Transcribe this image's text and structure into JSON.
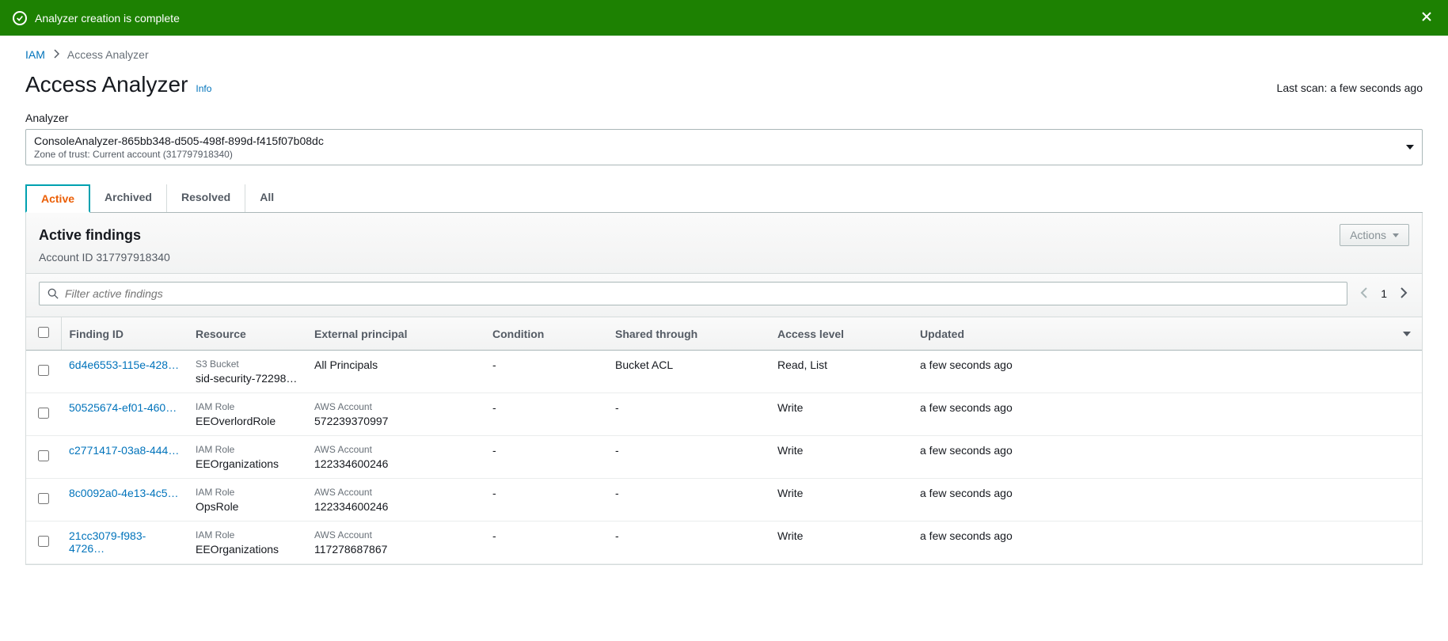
{
  "notification": {
    "message": "Analyzer creation is complete"
  },
  "breadcrumb": {
    "root": "IAM",
    "current": "Access Analyzer"
  },
  "header": {
    "title": "Access Analyzer",
    "info": "Info",
    "last_scan": "Last scan: a few seconds ago"
  },
  "analyzer": {
    "label": "Analyzer",
    "name": "ConsoleAnalyzer-865bb348-d505-498f-899d-f415f07b08dc",
    "zone": "Zone of trust: Current account (317797918340)"
  },
  "tabs": {
    "active": "Active",
    "archived": "Archived",
    "resolved": "Resolved",
    "all": "All"
  },
  "panel": {
    "title": "Active findings",
    "account": "Account ID 317797918340",
    "actions": "Actions",
    "filter_placeholder": "Filter active findings",
    "page": "1"
  },
  "columns": {
    "finding_id": "Finding ID",
    "resource": "Resource",
    "external_principal": "External principal",
    "condition": "Condition",
    "shared_through": "Shared through",
    "access_level": "Access level",
    "updated": "Updated"
  },
  "rows": [
    {
      "id": "6d4e6553-115e-428…",
      "res_type": "S3 Bucket",
      "res_name": "sid-security-72298…",
      "ep_type": "",
      "ep_name": "All Principals",
      "condition": "-",
      "shared": "Bucket ACL",
      "access": "Read, List",
      "updated": "a few seconds ago"
    },
    {
      "id": "50525674-ef01-460…",
      "res_type": "IAM Role",
      "res_name": "EEOverlordRole",
      "ep_type": "AWS Account",
      "ep_name": "572239370997",
      "condition": "-",
      "shared": "-",
      "access": "Write",
      "updated": "a few seconds ago"
    },
    {
      "id": "c2771417-03a8-444…",
      "res_type": "IAM Role",
      "res_name": "EEOrganizations",
      "ep_type": "AWS Account",
      "ep_name": "122334600246",
      "condition": "-",
      "shared": "-",
      "access": "Write",
      "updated": "a few seconds ago"
    },
    {
      "id": "8c0092a0-4e13-4c5…",
      "res_type": "IAM Role",
      "res_name": "OpsRole",
      "ep_type": "AWS Account",
      "ep_name": "122334600246",
      "condition": "-",
      "shared": "-",
      "access": "Write",
      "updated": "a few seconds ago"
    },
    {
      "id": "21cc3079-f983-4726…",
      "res_type": "IAM Role",
      "res_name": "EEOrganizations",
      "ep_type": "AWS Account",
      "ep_name": "117278687867",
      "condition": "-",
      "shared": "-",
      "access": "Write",
      "updated": "a few seconds ago"
    }
  ]
}
